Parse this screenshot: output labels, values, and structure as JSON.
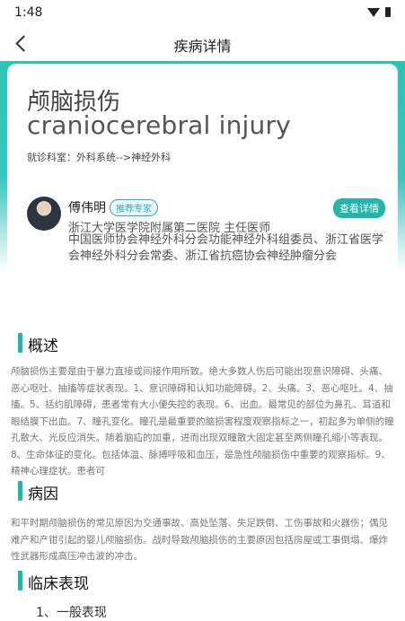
{
  "status": {
    "time": "1:48"
  },
  "nav": {
    "title": "疾病详情"
  },
  "disease": {
    "name_cn": "颅脑损伤",
    "name_en": "craniocerebral injury",
    "department": "就诊科室：外科系统-->神经外科"
  },
  "doctor": {
    "name": "傅伟明",
    "badge": "推荐专家",
    "view_label": "查看详情",
    "hospital": "浙江大学医学院附属第二医院  主任医师",
    "titles": "中国医师协会神经外科分会功能神经外科组委员、浙江省医学会神经外科分会常委、浙江省抗癌协会神经肿瘤分会"
  },
  "sections": {
    "overview": {
      "title": "概述",
      "body": "颅脑损伤主要是由于暴力直接或间接作用所致。绝大多数人伤后可能出现意识障碍、头痛、恶心呕吐、抽搐等症状表现。1、意识障碍和认知功能障碍。2、头痛。3、恶心呕吐。4、抽搐。5、括约肌障碍，患者常有大小便失控的表现。6、出血。最常见的部位为鼻孔、耳道和眼结膜下出血。7、瞳孔变化。瞳孔是最重要的脑损害程度观察指标之一，初起多为单侧的瞳孔散大、光反应消失。随着脑疝的加重，进而出现双瞳散大固定甚至两侧瞳孔缩小等表现。8、生命体征的变化。包括体温、脉搏呼吸和血压，是急性颅脑损伤中重要的观察指标。9、精神心理症状。患者可"
    },
    "cause": {
      "title": "病因",
      "body": "和平时期颅脑损伤的常见原因为交通事故、高处坠落、失足跌倒、工伤事故和火器伤；偶见难产和产钳引起的婴儿颅脑损伤。战时导致颅脑损伤的主要原因包括房屋或工事倒塌、爆炸性武器形成高压冲击波的冲击。"
    },
    "clinical": {
      "title": "临床表现",
      "sub": "1、一般表现"
    }
  }
}
